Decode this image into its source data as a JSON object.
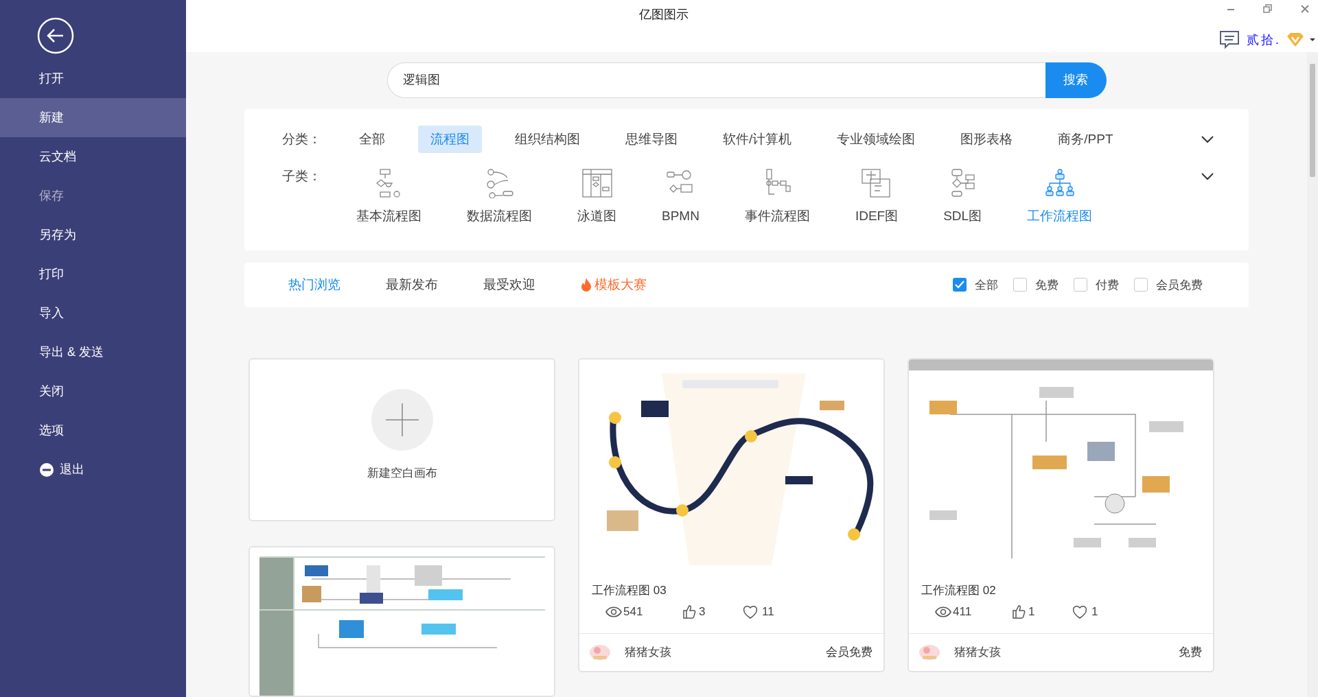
{
  "window": {
    "title": "亿图图示"
  },
  "user": {
    "name": "贰拾."
  },
  "sidebar": {
    "items": [
      {
        "label": "打开",
        "selected": false,
        "disabled": false,
        "kind": "item"
      },
      {
        "label": "新建",
        "selected": true,
        "disabled": false,
        "kind": "item"
      },
      {
        "label": "云文档",
        "selected": false,
        "disabled": false,
        "kind": "item"
      },
      {
        "label": "保存",
        "selected": false,
        "disabled": true,
        "kind": "item"
      },
      {
        "label": "另存为",
        "selected": false,
        "disabled": false,
        "kind": "item"
      },
      {
        "label": "打印",
        "selected": false,
        "disabled": false,
        "kind": "item"
      },
      {
        "label": "导入",
        "selected": false,
        "disabled": false,
        "kind": "item"
      },
      {
        "label": "导出 & 发送",
        "selected": false,
        "disabled": false,
        "kind": "item"
      },
      {
        "label": "关闭",
        "selected": false,
        "disabled": false,
        "kind": "item"
      },
      {
        "label": "选项",
        "selected": false,
        "disabled": false,
        "kind": "item"
      },
      {
        "label": "退出",
        "selected": false,
        "disabled": false,
        "kind": "exit"
      }
    ]
  },
  "search": {
    "value": "逻辑图",
    "button": "搜索"
  },
  "categories": {
    "label": "分类：",
    "items": [
      {
        "label": "全部",
        "selected": false
      },
      {
        "label": "流程图",
        "selected": true
      },
      {
        "label": "组织结构图",
        "selected": false
      },
      {
        "label": "思维导图",
        "selected": false
      },
      {
        "label": "软件/计算机",
        "selected": false
      },
      {
        "label": "专业领域绘图",
        "selected": false
      },
      {
        "label": "图形表格",
        "selected": false
      },
      {
        "label": "商务/PPT",
        "selected": false
      }
    ]
  },
  "subcategories": {
    "label": "子类：",
    "items": [
      {
        "label": "基本流程图",
        "selected": false,
        "kind": "basic"
      },
      {
        "label": "数据流程图",
        "selected": false,
        "kind": "data"
      },
      {
        "label": "泳道图",
        "selected": false,
        "kind": "swimlane"
      },
      {
        "label": "BPMN",
        "selected": false,
        "kind": "bpmn"
      },
      {
        "label": "事件流程图",
        "selected": false,
        "kind": "event"
      },
      {
        "label": "IDEF图",
        "selected": false,
        "kind": "idef"
      },
      {
        "label": "SDL图",
        "selected": false,
        "kind": "sdl"
      },
      {
        "label": "工作流程图",
        "selected": true,
        "kind": "workflow"
      }
    ]
  },
  "sort_tabs": [
    {
      "label": "热门浏览",
      "selected": true,
      "kind": "tab"
    },
    {
      "label": "最新发布",
      "selected": false,
      "kind": "tab"
    },
    {
      "label": "最受欢迎",
      "selected": false,
      "kind": "tab"
    },
    {
      "label": "模板大赛",
      "selected": false,
      "kind": "contest"
    }
  ],
  "filters": [
    {
      "label": "全部",
      "checked": true
    },
    {
      "label": "免费",
      "checked": false
    },
    {
      "label": "付费",
      "checked": false
    },
    {
      "label": "会员免费",
      "checked": false
    }
  ],
  "blank_canvas": {
    "label": "新建空白画布"
  },
  "templates": [
    {
      "kind": "card",
      "title": "工作流程图 03",
      "views": "541",
      "likes": "3",
      "favorites": "11",
      "author": "猪猪女孩",
      "price": "会员免费"
    },
    {
      "kind": "card",
      "title": "工作流程图 02",
      "views": "411",
      "likes": "1",
      "favorites": "1",
      "author": "猪猪女孩",
      "price": "免费"
    },
    {
      "kind": "picture"
    }
  ]
}
